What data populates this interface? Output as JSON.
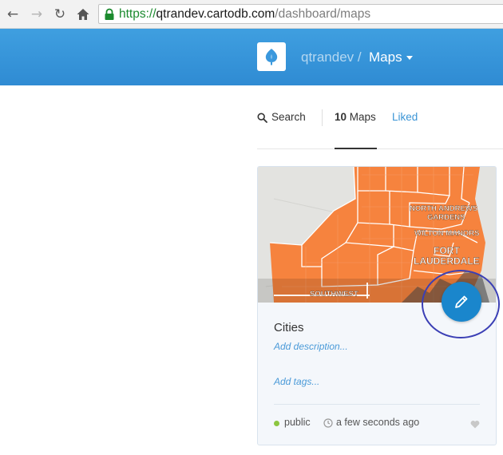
{
  "browser": {
    "url_scheme": "https://",
    "url_host": "qtrandev.cartodb.com",
    "url_path": "/dashboard/maps",
    "icons": [
      "back-arrow-icon",
      "forward-arrow-icon",
      "reload-icon",
      "home-icon",
      "lock-icon"
    ]
  },
  "header": {
    "user": "qtrandev",
    "separator": "/",
    "section": "Maps",
    "brand_color": "#3a98dd"
  },
  "filters": {
    "search_label": "Search",
    "maps_count": "10",
    "maps_label": "Maps",
    "liked_label": "Liked"
  },
  "map_card": {
    "thumbnail_labels": [
      "NORTH ANDREWS",
      "GARDENS",
      "WILTON MANORS",
      "FORT",
      "LAUDERDALE",
      "SOUTHWEST"
    ],
    "title": "Cities",
    "description_placeholder": "Add description...",
    "tags_placeholder": "Add tags...",
    "privacy": "public",
    "privacy_color": "#8cc640",
    "updated": "a few seconds ago",
    "edit_icon": "pencil-icon",
    "accent_color": "#1a86cc"
  }
}
